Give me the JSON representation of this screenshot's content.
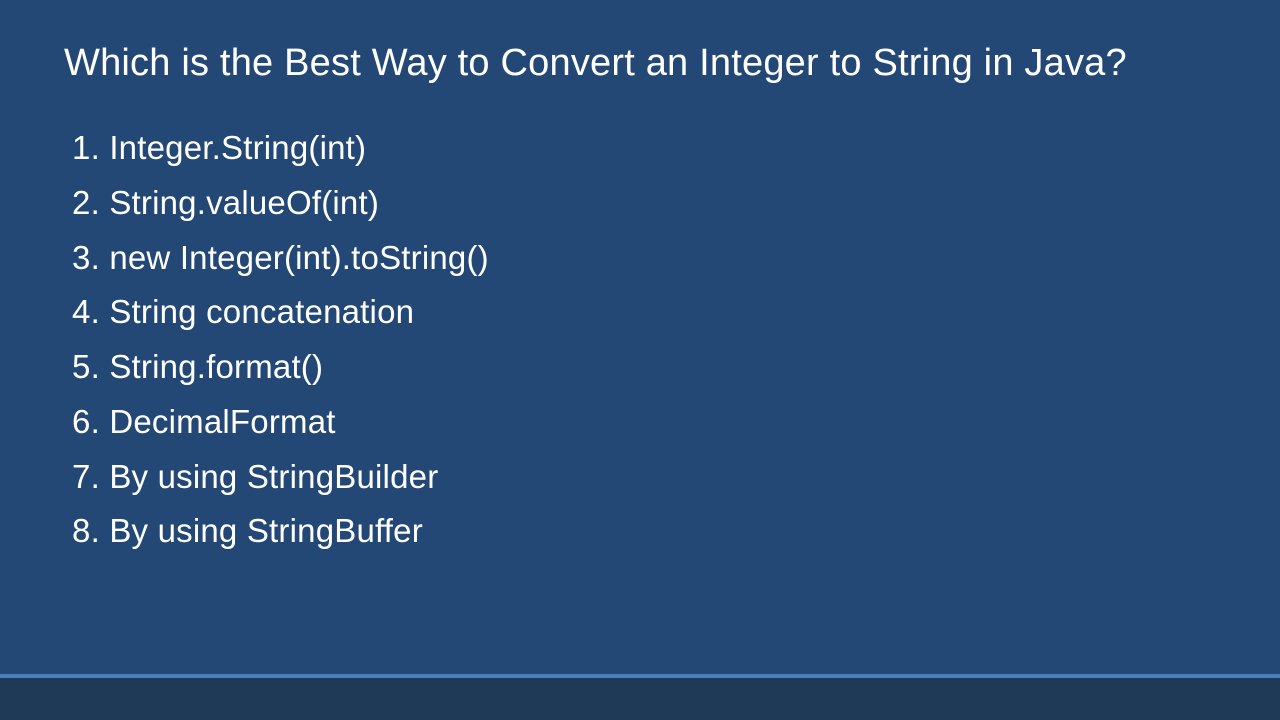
{
  "slide": {
    "title": "Which is the Best Way to Convert an Integer to String in Java?",
    "items": [
      "Integer.String(int)",
      "String.valueOf(int)",
      "new Integer(int).toString()",
      "String concatenation",
      "String.format()",
      "DecimalFormat",
      "By using StringBuilder",
      "By using StringBuffer"
    ]
  }
}
